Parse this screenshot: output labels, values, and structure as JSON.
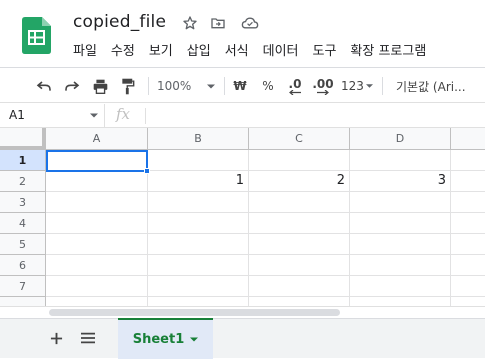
{
  "doc": {
    "title": "copied_file"
  },
  "menu": [
    "파일",
    "수정",
    "보기",
    "삽입",
    "서식",
    "데이터",
    "도구",
    "확장 프로그램"
  ],
  "toolbar": {
    "zoom": "100%",
    "currency": "₩",
    "percent": "%",
    "dec_decrease": ".0",
    "dec_increase": ".00",
    "number_format": "123",
    "font": "기본값 (Ari..."
  },
  "formula_bar": {
    "name_box": "A1",
    "fx_label": "fx",
    "value": ""
  },
  "grid": {
    "columns": [
      "A",
      "B",
      "C",
      "D"
    ],
    "rows": [
      "1",
      "2",
      "3",
      "4",
      "5",
      "6",
      "7"
    ],
    "cells": {
      "B2": "1",
      "C2": "2",
      "D2": "3"
    },
    "active_cell": "A1"
  },
  "sheets": {
    "tabs": [
      "Sheet1"
    ]
  },
  "colors": {
    "accent": "#1a73e8",
    "sheets_green": "#188038",
    "logo_green": "#23a566"
  }
}
